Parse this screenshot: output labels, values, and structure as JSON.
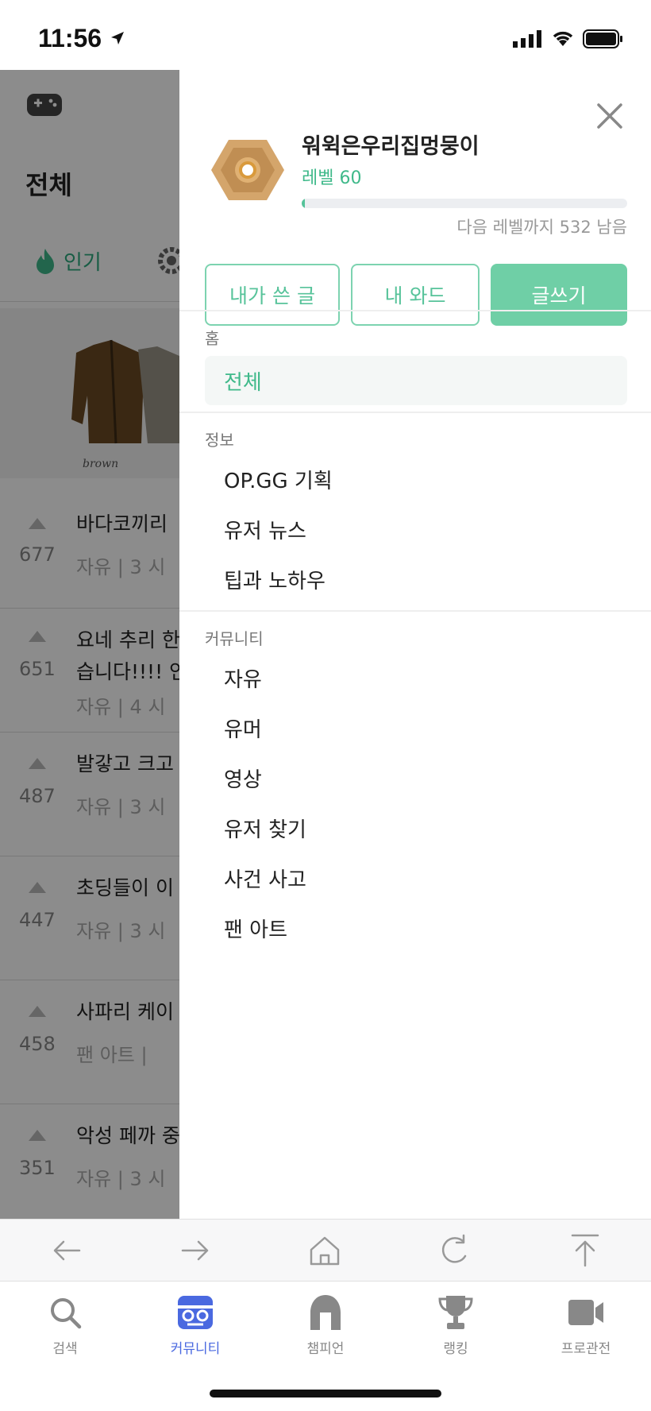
{
  "status_bar": {
    "time": "11:56"
  },
  "background_page": {
    "title": "전체",
    "popular_tab": "인기",
    "posts": [
      {
        "votes": "677",
        "title": "바다코끼리",
        "category": "자유",
        "time": "3 시"
      },
      {
        "votes": "651",
        "title": "요네 추리 한",
        "title2": "습니다!!!! 인",
        "category": "자유",
        "time": "4 시"
      },
      {
        "votes": "487",
        "title": "발갛고 크고",
        "category": "자유",
        "time": "3 시"
      },
      {
        "votes": "447",
        "title": "초딩들이 이",
        "category": "자유",
        "time": "3 시"
      },
      {
        "votes": "458",
        "title": "사파리 케이",
        "category": "팬 아트",
        "time": ""
      },
      {
        "votes": "351",
        "title": "악성 페까 중",
        "category": "자유",
        "time": "3 시"
      }
    ]
  },
  "drawer": {
    "username": "워윅은우리집멍뭉이",
    "level": "레벨 60",
    "progress": 0.01,
    "remaining": "다음 레벨까지 532 남음",
    "buttons": {
      "my_posts": "내가 쓴 글",
      "my_ward": "내 와드",
      "write": "글쓰기"
    },
    "sections": {
      "home": {
        "title": "홈",
        "items": [
          "전체"
        ]
      },
      "info": {
        "title": "정보",
        "items": [
          "OP.GG 기획",
          "유저 뉴스",
          "팁과 노하우"
        ]
      },
      "community": {
        "title": "커뮤니티",
        "items": [
          "자유",
          "유머",
          "영상",
          "유저 찾기",
          "사건 사고",
          "팬 아트"
        ]
      }
    }
  },
  "tabbar": {
    "tabs": [
      {
        "label": "검색",
        "icon": "search-icon"
      },
      {
        "label": "커뮤니티",
        "icon": "community-icon"
      },
      {
        "label": "챔피언",
        "icon": "helmet-icon"
      },
      {
        "label": "랭킹",
        "icon": "trophy-icon"
      },
      {
        "label": "프로관전",
        "icon": "video-camera-icon"
      }
    ]
  },
  "colors": {
    "accent": "#3fb98a",
    "active_tab": "#4a69e0"
  }
}
